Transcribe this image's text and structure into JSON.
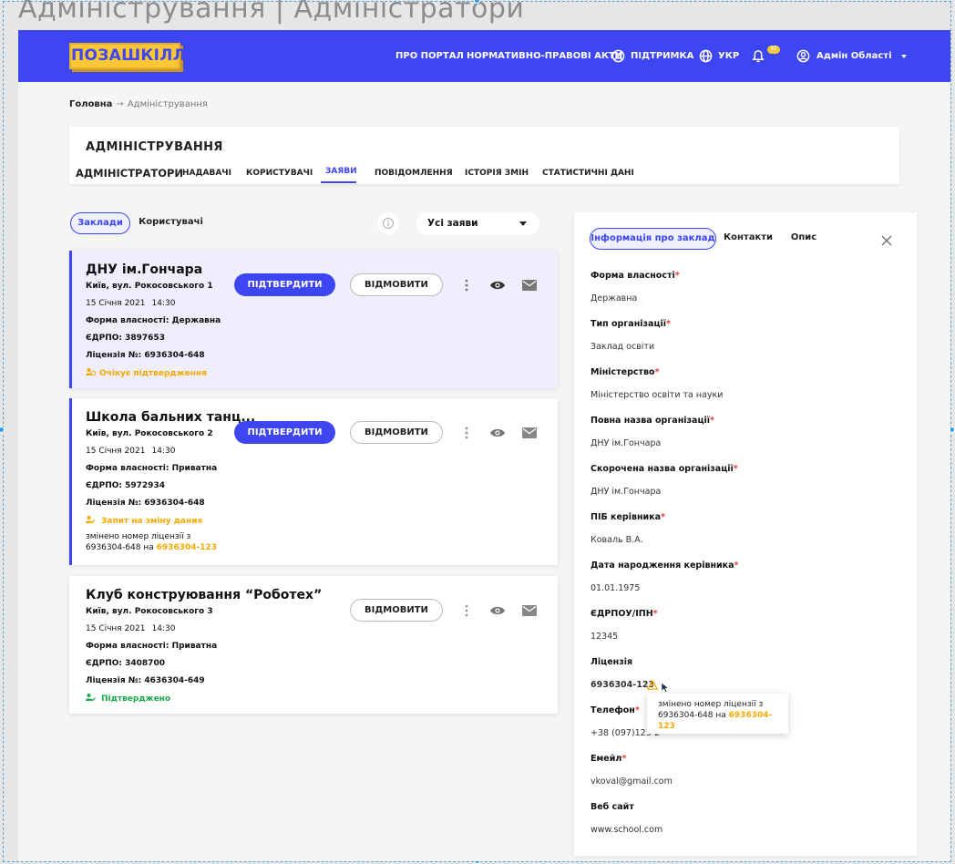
{
  "frame_title": "Адміністрування | Адміністратори",
  "header": {
    "logo": "ПОЗАШКІЛЛЯ",
    "nav": {
      "about": "ПРО ПОРТАЛ",
      "legal": "НОРМАТИВНО-ПРАВОВІ АКТИ",
      "support": "ПІДТРИМКА",
      "lang": "УКР",
      "notifications_count": "37",
      "user": "Адмін Області"
    }
  },
  "breadcrumb": {
    "home": "Головна",
    "separator": "→",
    "current": "Адміністрування"
  },
  "admin": {
    "title": "АДМІНІСТРУВАННЯ",
    "tabs": [
      "АДМІНІСТРАТОРИ",
      "НАДАВАЧІ",
      "КОРИСТУВАЧІ",
      "ЗАЯВИ",
      "ПОВІДОМЛЕННЯ",
      "ІСТОРІЯ ЗМІН",
      "СТАТИСТИЧНІ ДАНІ"
    ],
    "active_tab": "ЗАЯВИ"
  },
  "filters": {
    "type_tabs": [
      "Заклади",
      "Користувачі"
    ],
    "active_type": "Заклади",
    "status_select": "Усі заяви"
  },
  "applications": [
    {
      "name": "ДНУ ім.Гончара",
      "address": "Київ, вул. Рокосовського 1",
      "date": "15 Січня 2021",
      "time": "14:30",
      "ownership": "Форма власності: Державна",
      "edrpo": "ЄДРПО: 3897653",
      "license": "Ліцензія №: 6936304-648",
      "status": "Очікує підтвердження",
      "approve_label": "ПІДТВЕРДИТИ",
      "reject_label": "ВІДМОВИТИ"
    },
    {
      "name": "Школа бальних танц...",
      "address": "Київ, вул. Рокосовського 2",
      "date": "15 Січня 2021",
      "time": "14:30",
      "ownership": "Форма власності: Приватна",
      "edrpo": "ЄДРПО: 5972934",
      "license": "Ліцензія №: 6936304-648",
      "status": "Запит на зміну даних",
      "change_note_1": "змінено номер ліцензії з",
      "change_note_2": "6936304-648 на",
      "change_note_new": "6936304-123",
      "approve_label": "ПІДТВЕРДИТИ",
      "reject_label": "ВІДМОВИТИ"
    },
    {
      "name": "Клуб конструювання “Роботех”",
      "address": "Київ, вул. Рокосовського 3",
      "date": "15 Січня 2021",
      "time": "14:30",
      "ownership": "Форма власності: Приватна",
      "edrpo": "ЄДРПО: 3408700",
      "license": "Ліцензія №: 4636304-649",
      "status": "Підтверджено",
      "reject_label": "ВІДМОВИТИ"
    }
  ],
  "detail": {
    "tabs": [
      "Інформація про заклад",
      "Контакти",
      "Опис"
    ],
    "active_tab": "Інформація про заклад",
    "fields": [
      {
        "label": "Форма власності",
        "value": "Державна",
        "required": true
      },
      {
        "label": "Тип організації",
        "value": "Заклад освіти",
        "required": true
      },
      {
        "label": "Міністерство",
        "value": "Міністерство освіти та науки",
        "required": true
      },
      {
        "label": "Повна назва організації",
        "value": "ДНУ ім.Гончара",
        "required": true
      },
      {
        "label": "Скорочена назва організації",
        "value": "ДНУ ім.Гончара",
        "required": true
      },
      {
        "label": "ПІБ керівника",
        "value": "Коваль В.А.",
        "required": true
      },
      {
        "label": "Дата народження керівника",
        "value": "01.01.1975",
        "required": true
      },
      {
        "label": "ЄДРПОУ/ІПН",
        "value": "12345",
        "required": true
      },
      {
        "label": "Ліцензія",
        "value": "6936304-123",
        "required": false
      },
      {
        "label": "Телефон",
        "value": "+38 (097)123-2",
        "required": true
      },
      {
        "label": "Емейл",
        "value": "vkoval@gmail.com",
        "required": true
      },
      {
        "label": "Веб сайт",
        "value": "www.school.com",
        "required": false
      }
    ],
    "tooltip": {
      "line1": "змінено номер ліцензії з",
      "line2": "6936304-648 на",
      "new_value": "6936304-123"
    }
  },
  "colors": {
    "primary": "#3d46f0",
    "brand_yellow": "#fcc737",
    "warning": "#f5a900",
    "success": "#1aa84a",
    "required": "#e23b3b"
  }
}
